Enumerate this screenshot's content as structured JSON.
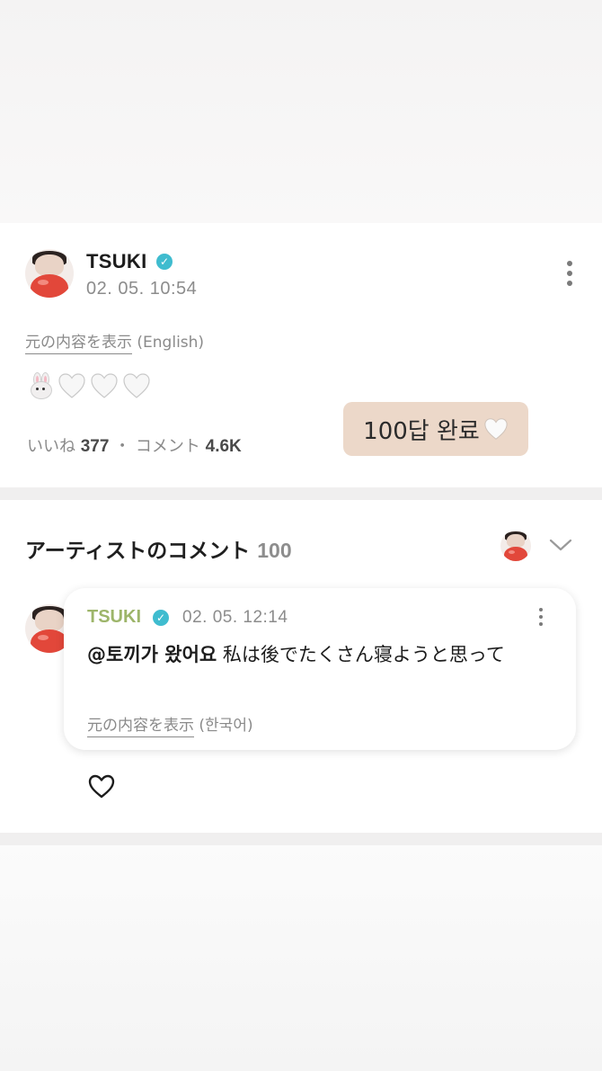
{
  "post": {
    "author": "TSUKI",
    "timestamp": "02. 05. 10:54",
    "translate_link": "元の内容を表示",
    "translate_lang": "(English)",
    "likes_label": "いいね",
    "likes_count": "377",
    "separator": "・",
    "comments_label": "コメント",
    "comments_count": "4.6K"
  },
  "sticker": {
    "text": "100답 완료"
  },
  "artist_comments": {
    "title": "アーティストのコメント",
    "count": "100"
  },
  "comment": {
    "author": "TSUKI",
    "timestamp": "02. 05. 12:14",
    "mention": "@토끼가 왔어요",
    "text": "私は後でたくさん寝ようと思って",
    "translate_link": "元の内容を表示",
    "translate_lang": "(한국어)"
  },
  "colors": {
    "verified": "#3fbccf",
    "comment_author": "#9db56a",
    "sticker_bg": "#ecd8c9"
  }
}
